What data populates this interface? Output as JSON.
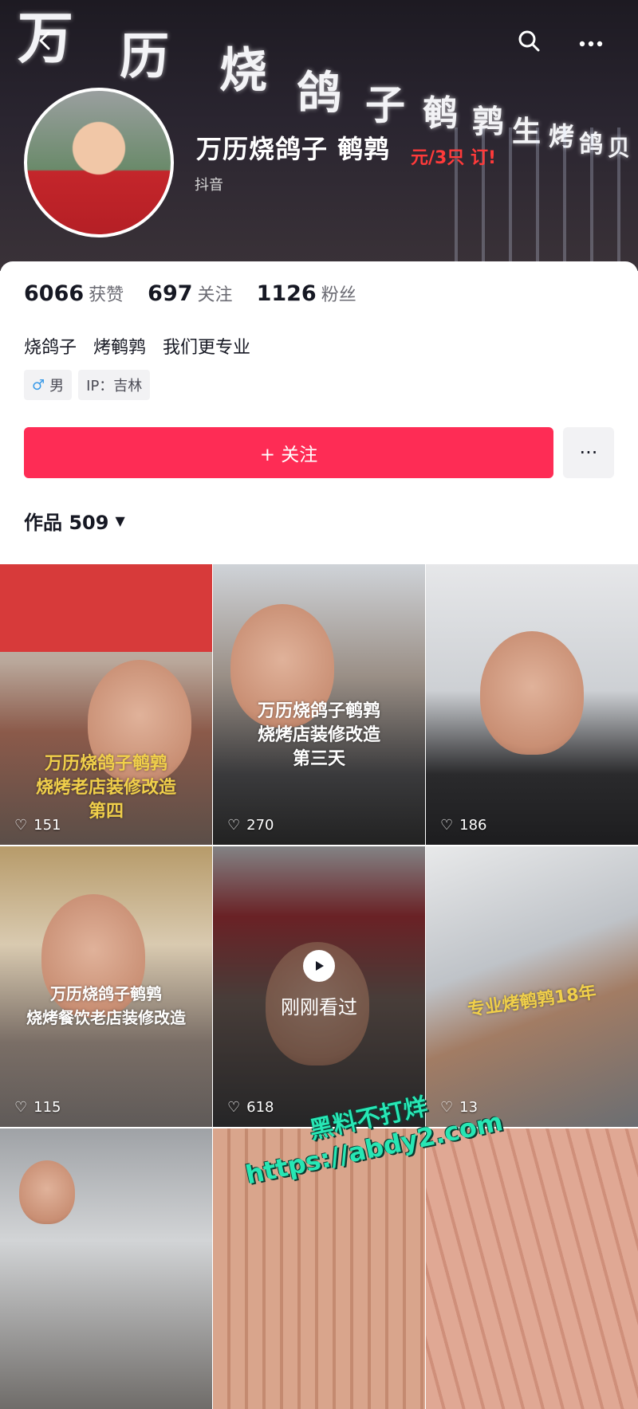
{
  "header": {
    "sign_text": [
      "万",
      "历",
      "烧",
      "鸽",
      "子",
      "鹌",
      "鹑",
      "生",
      "烤",
      "鸽",
      "贝"
    ],
    "red_sign": "元/3只  订!",
    "profile_name": "万历烧鸽子 鹌鹑",
    "platform_label": "抖音",
    "icons": [
      "back-icon",
      "search-icon",
      "more-icon"
    ]
  },
  "stats": [
    {
      "value": "6066",
      "label": "获赞"
    },
    {
      "value": "697",
      "label": "关注"
    },
    {
      "value": "1126",
      "label": "粉丝"
    }
  ],
  "bio": "烧鸽子   烤鹌鹑   我们更专业",
  "tags": {
    "gender_symbol": "♂",
    "gender": "男",
    "ip": "IP：吉林"
  },
  "follow_label": "+ 关注",
  "more_label": "···",
  "works": {
    "label": "作品 509",
    "arrow": "▼"
  },
  "videos": [
    {
      "likes": "151",
      "caption": "万历烧鸽子鹌鹑\n烧烤老店装修改造\n第四"
    },
    {
      "likes": "270",
      "caption": "万历烧鸽子鹌鹑\n烧烤店装修改造\n第三天"
    },
    {
      "likes": "186",
      "caption": ""
    },
    {
      "likes": "115",
      "caption": "万历烧鸽子鹌鹑\n烧烤餐饮老店装修改造"
    },
    {
      "likes": "618",
      "caption": "",
      "watched": "刚刚看过"
    },
    {
      "likes": "13",
      "caption": "专业烤鹌鹑18年"
    },
    {
      "likes": "",
      "caption": ""
    },
    {
      "likes": "",
      "caption": ""
    },
    {
      "likes": "",
      "caption": ""
    }
  ],
  "watermark": {
    "line1": "黑料不打烊",
    "line2": "https://abdy2.com"
  },
  "colors": {
    "accent": "#fe2c55",
    "watermark": "#27e6b4"
  }
}
